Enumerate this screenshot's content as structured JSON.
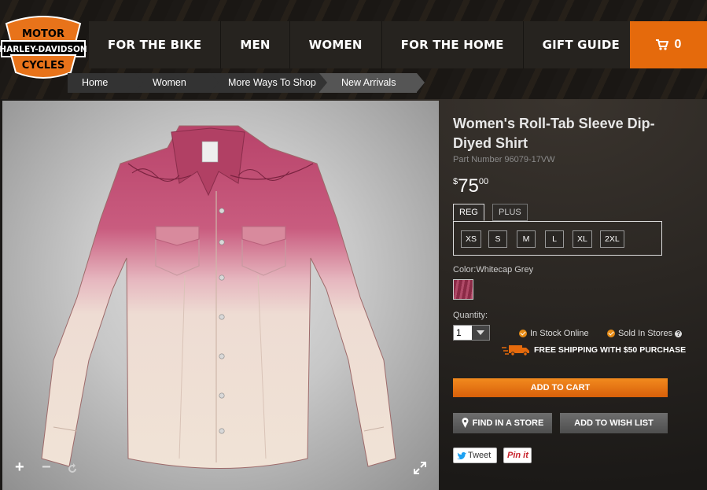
{
  "brand": {
    "logo_lines": [
      "MOTOR",
      "HARLEY-DAVIDSON",
      "CYCLES"
    ],
    "colors": {
      "accent": "#e56a0c",
      "logo_orange": "#e8731a"
    }
  },
  "nav": {
    "items": [
      {
        "label": "FOR THE BIKE"
      },
      {
        "label": "MEN"
      },
      {
        "label": "WOMEN"
      },
      {
        "label": "FOR THE HOME"
      },
      {
        "label": "GIFT GUIDE"
      }
    ],
    "cart": {
      "icon": "cart-icon",
      "count": "0"
    }
  },
  "breadcrumb": {
    "items": [
      {
        "label": "Home"
      },
      {
        "label": "Women"
      },
      {
        "label": "More Ways To Shop"
      },
      {
        "label": "New Arrivals"
      }
    ]
  },
  "image_controls": {
    "zoom_in": "+",
    "zoom_out": "−",
    "reset_icon": "rotate-icon",
    "expand_icon": "expand-icon"
  },
  "product": {
    "title": "Women's Roll-Tab Sleeve Dip-Diyed Shirt",
    "part_number": "Part Number  96079-17VW",
    "price": {
      "currency": "$",
      "dollars": "75",
      "cents": "00"
    },
    "fit_tabs": [
      {
        "label": "REG",
        "selected": true
      },
      {
        "label": "PLUS",
        "selected": false
      }
    ],
    "sizes": [
      "XS",
      "S",
      "M",
      "L",
      "XL",
      "2XL"
    ],
    "color_label": "Color:Whitecap Grey",
    "quantity_label": "Quantity:",
    "quantity_value": "1",
    "in_stock_online": "In Stock Online",
    "sold_in_stores": "Sold In Stores",
    "help_mark": "?",
    "shipping": "FREE SHIPPING WITH $50 PURCHASE",
    "add_to_cart": "ADD TO CART",
    "find_in_store": "FIND IN A STORE",
    "add_to_wish_list": "ADD TO WISH LIST",
    "tweet": "Tweet",
    "pin": "Pin it"
  }
}
